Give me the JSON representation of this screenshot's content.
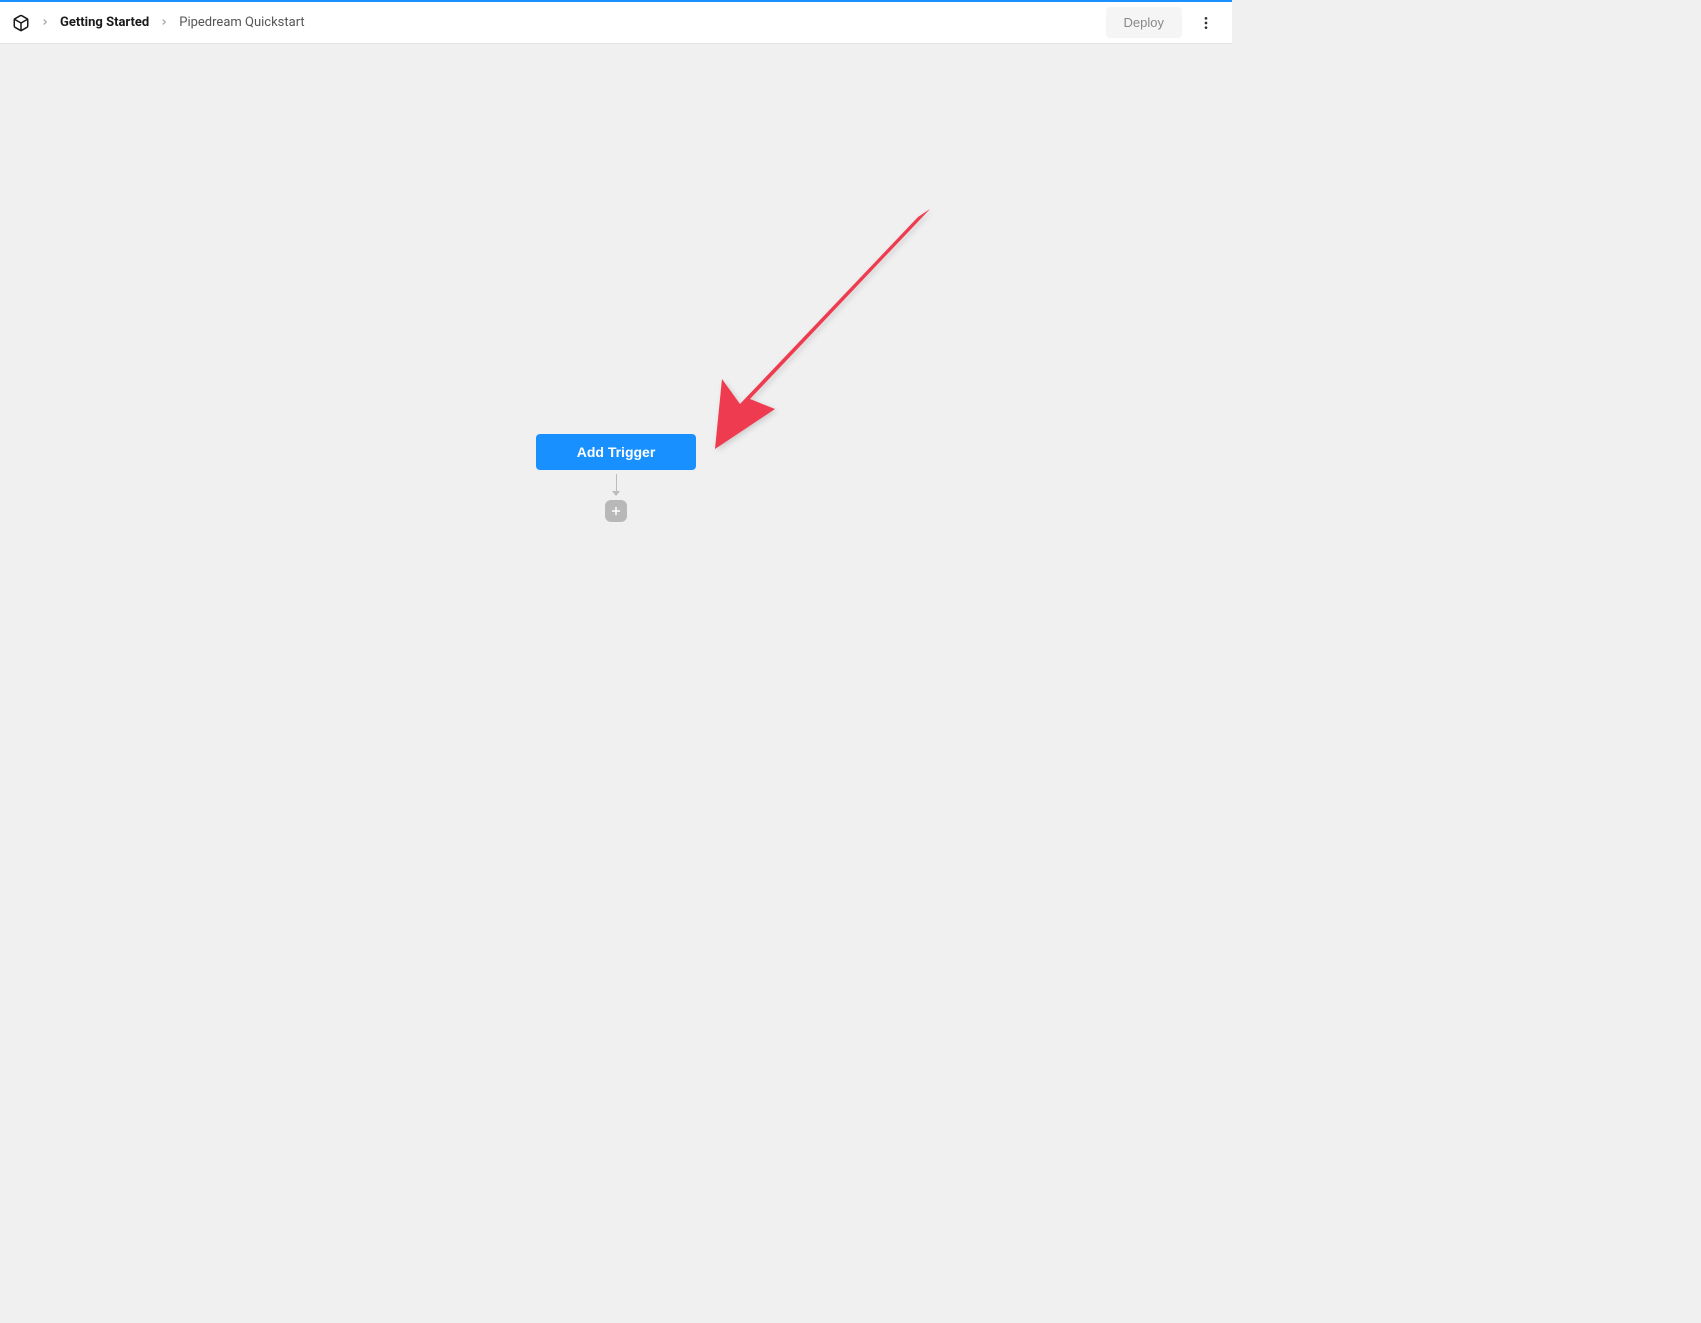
{
  "header": {
    "breadcrumb": {
      "main": "Getting Started",
      "sub": "Pipedream Quickstart"
    },
    "deploy_label": "Deploy"
  },
  "canvas": {
    "add_trigger_label": "Add Trigger"
  },
  "colors": {
    "accent": "#1890ff",
    "annotation": "#ef3b50"
  }
}
